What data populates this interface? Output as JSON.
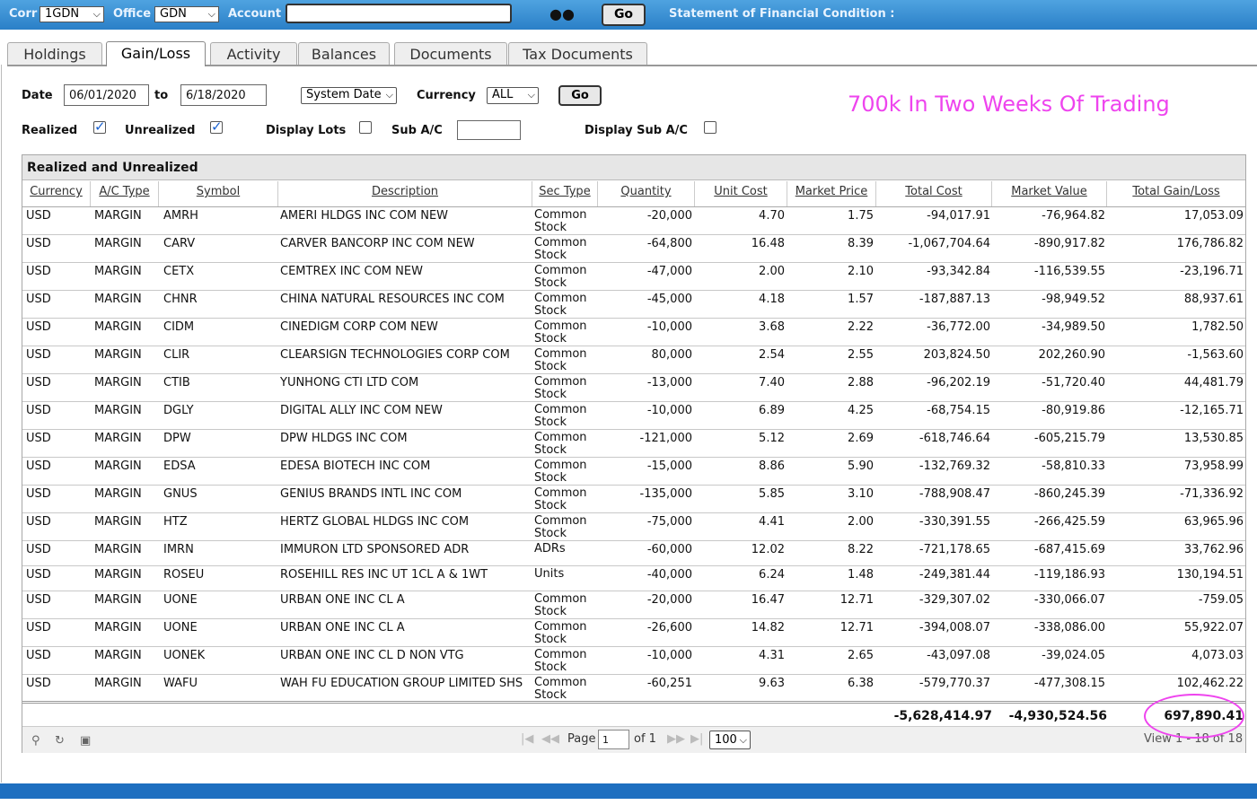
{
  "topbar": {
    "corr_label": "Corr",
    "corr_value": "1GDN",
    "office_label": "Office",
    "office_value": "GDN",
    "account_label": "Account",
    "account_value": "",
    "go_label": "Go",
    "title": "Statement of Financial Condition :"
  },
  "tabs": [
    {
      "label": "Holdings",
      "active": false
    },
    {
      "label": "Gain/Loss",
      "active": true
    },
    {
      "label": "Activity",
      "active": false
    },
    {
      "label": "Balances",
      "active": false
    },
    {
      "label": "Documents",
      "active": false
    },
    {
      "label": "Tax Documents",
      "active": false
    }
  ],
  "filters": {
    "date_label": "Date",
    "date_from": "06/01/2020",
    "to_label": "to",
    "date_to": "6/18/2020",
    "date_type": "System Date",
    "currency_label": "Currency",
    "currency_value": "ALL",
    "go_label": "Go",
    "realized_label": "Realized",
    "realized_checked": true,
    "unrealized_label": "Unrealized",
    "unrealized_checked": true,
    "display_lots_label": "Display Lots",
    "display_lots_checked": false,
    "sub_ac_label": "Sub A/C",
    "sub_ac_value": "",
    "display_sub_ac_label": "Display Sub A/C",
    "display_sub_ac_checked": false
  },
  "annotation": "700k In Two Weeks Of Trading",
  "grid": {
    "title": "Realized and Unrealized",
    "columns": [
      "Currency",
      "A/C Type",
      "Symbol",
      "Description",
      "Sec Type",
      "Quantity",
      "Unit Cost",
      "Market Price",
      "Total Cost",
      "Market Value",
      "Total Gain/Loss"
    ],
    "rows": [
      [
        "USD",
        "MARGIN",
        "AMRH",
        "AMERI HLDGS INC COM NEW",
        "Common Stock",
        "-20,000",
        "4.70",
        "1.75",
        "-94,017.91",
        "-76,964.82",
        "17,053.09"
      ],
      [
        "USD",
        "MARGIN",
        "CARV",
        "CARVER BANCORP INC COM NEW",
        "Common Stock",
        "-64,800",
        "16.48",
        "8.39",
        "-1,067,704.64",
        "-890,917.82",
        "176,786.82"
      ],
      [
        "USD",
        "MARGIN",
        "CETX",
        "CEMTREX INC COM NEW",
        "Common Stock",
        "-47,000",
        "2.00",
        "2.10",
        "-93,342.84",
        "-116,539.55",
        "-23,196.71"
      ],
      [
        "USD",
        "MARGIN",
        "CHNR",
        "CHINA NATURAL RESOURCES INC COM",
        "Common Stock",
        "-45,000",
        "4.18",
        "1.57",
        "-187,887.13",
        "-98,949.52",
        "88,937.61"
      ],
      [
        "USD",
        "MARGIN",
        "CIDM",
        "CINEDIGM CORP COM NEW",
        "Common Stock",
        "-10,000",
        "3.68",
        "2.22",
        "-36,772.00",
        "-34,989.50",
        "1,782.50"
      ],
      [
        "USD",
        "MARGIN",
        "CLIR",
        "CLEARSIGN TECHNOLOGIES CORP COM",
        "Common Stock",
        "80,000",
        "2.54",
        "2.55",
        "203,824.50",
        "202,260.90",
        "-1,563.60"
      ],
      [
        "USD",
        "MARGIN",
        "CTIB",
        "YUNHONG CTI LTD COM",
        "Common Stock",
        "-13,000",
        "7.40",
        "2.88",
        "-96,202.19",
        "-51,720.40",
        "44,481.79"
      ],
      [
        "USD",
        "MARGIN",
        "DGLY",
        "DIGITAL ALLY INC COM NEW",
        "Common Stock",
        "-10,000",
        "6.89",
        "4.25",
        "-68,754.15",
        "-80,919.86",
        "-12,165.71"
      ],
      [
        "USD",
        "MARGIN",
        "DPW",
        "DPW HLDGS INC COM",
        "Common Stock",
        "-121,000",
        "5.12",
        "2.69",
        "-618,746.64",
        "-605,215.79",
        "13,530.85"
      ],
      [
        "USD",
        "MARGIN",
        "EDSA",
        "EDESA BIOTECH INC COM",
        "Common Stock",
        "-15,000",
        "8.86",
        "5.90",
        "-132,769.32",
        "-58,810.33",
        "73,958.99"
      ],
      [
        "USD",
        "MARGIN",
        "GNUS",
        "GENIUS BRANDS INTL INC COM",
        "Common Stock",
        "-135,000",
        "5.85",
        "3.10",
        "-788,908.47",
        "-860,245.39",
        "-71,336.92"
      ],
      [
        "USD",
        "MARGIN",
        "HTZ",
        "HERTZ GLOBAL HLDGS INC COM",
        "Common Stock",
        "-75,000",
        "4.41",
        "2.00",
        "-330,391.55",
        "-266,425.59",
        "63,965.96"
      ],
      [
        "USD",
        "MARGIN",
        "IMRN",
        "IMMURON LTD SPONSORED ADR",
        "ADRs",
        "-60,000",
        "12.02",
        "8.22",
        "-721,178.65",
        "-687,415.69",
        "33,762.96"
      ],
      [
        "USD",
        "MARGIN",
        "ROSEU",
        "ROSEHILL RES INC UT 1CL A & 1WT",
        "Units",
        "-40,000",
        "6.24",
        "1.48",
        "-249,381.44",
        "-119,186.93",
        "130,194.51"
      ],
      [
        "USD",
        "MARGIN",
        "UONE",
        "URBAN ONE INC CL A",
        "Common Stock",
        "-20,000",
        "16.47",
        "12.71",
        "-329,307.02",
        "-330,066.07",
        "-759.05"
      ],
      [
        "USD",
        "MARGIN",
        "UONE",
        "URBAN ONE INC CL A",
        "Common Stock",
        "-26,600",
        "14.82",
        "12.71",
        "-394,008.07",
        "-338,086.00",
        "55,922.07"
      ],
      [
        "USD",
        "MARGIN",
        "UONEK",
        "URBAN ONE INC CL D NON VTG",
        "Common Stock",
        "-10,000",
        "4.31",
        "2.65",
        "-43,097.08",
        "-39,024.05",
        "4,073.03"
      ],
      [
        "USD",
        "MARGIN",
        "WAFU",
        "WAH FU EDUCATION GROUP LIMITED SHS",
        "Common Stock",
        "-60,251",
        "9.63",
        "6.38",
        "-579,770.37",
        "-477,308.15",
        "102,462.22"
      ]
    ],
    "totals": {
      "total_cost": "-5,628,414.97",
      "market_value": "-4,930,524.56",
      "total_gain_loss": "697,890.41"
    },
    "footer": {
      "page_label": "Page",
      "page_value": "1",
      "of_label": "of 1",
      "per_page": "100",
      "view_text": "View 1 - 18 of 18"
    }
  }
}
